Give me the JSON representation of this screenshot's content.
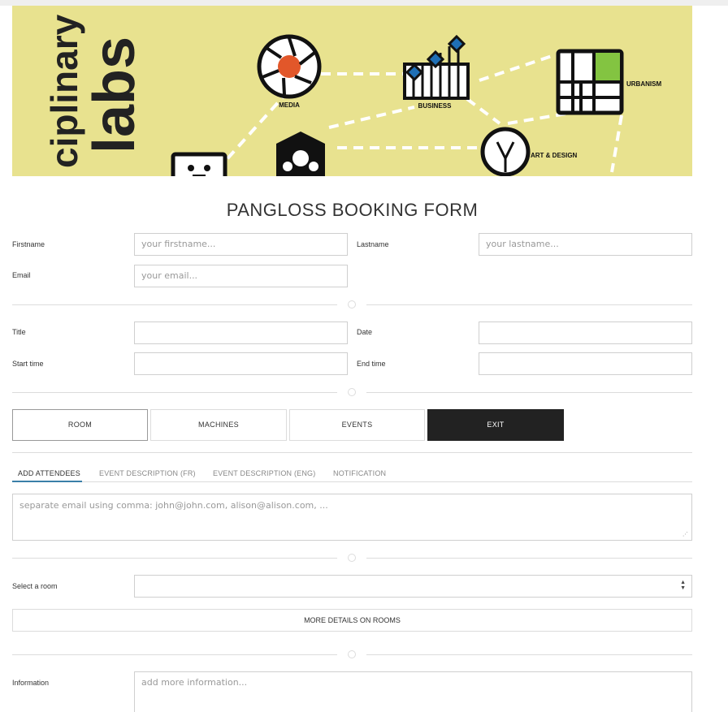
{
  "banner": {
    "word_vertical": "ciplinary",
    "word_labs": "labs",
    "icons": {
      "media": "MEDIA",
      "business": "BUSINESS",
      "urbanism": "URBANISM",
      "art_design": "ART & DESIGN"
    }
  },
  "form": {
    "title": "PANGLOSS BOOKING FORM",
    "firstname": {
      "label": "Firstname",
      "placeholder": "your firstname..."
    },
    "lastname": {
      "label": "Lastname",
      "placeholder": "your lastname..."
    },
    "email": {
      "label": "Email",
      "placeholder": "your email..."
    },
    "title_field": {
      "label": "Title"
    },
    "date": {
      "label": "Date"
    },
    "start_time": {
      "label": "Start time"
    },
    "end_time": {
      "label": "End time"
    }
  },
  "buttons": {
    "room": "ROOM",
    "machines": "MACHINES",
    "events": "EVENTS",
    "exit": "EXIT"
  },
  "tabs": [
    {
      "label": "ADD ATTENDEES",
      "active": true
    },
    {
      "label": "EVENT DESCRIPTION (FR)",
      "active": false
    },
    {
      "label": "EVENT DESCRIPTION (ENG)",
      "active": false
    },
    {
      "label": "NOTIFICATION",
      "active": false
    }
  ],
  "attendees": {
    "placeholder": "separate email using comma: john@john.com, alison@alison.com, ..."
  },
  "room_select": {
    "label": "Select a room",
    "value": ""
  },
  "more_details": "MORE DETAILS ON ROOMS",
  "information": {
    "label": "Information",
    "placeholder": "add more information..."
  },
  "colors": {
    "banner_bg": "#e8e28f",
    "media_orange": "#e2572a",
    "business_blue": "#1f6fb5",
    "urbanism_green": "#83c441",
    "exit_bg": "#222222",
    "tab_underline": "#3a7fa8"
  }
}
